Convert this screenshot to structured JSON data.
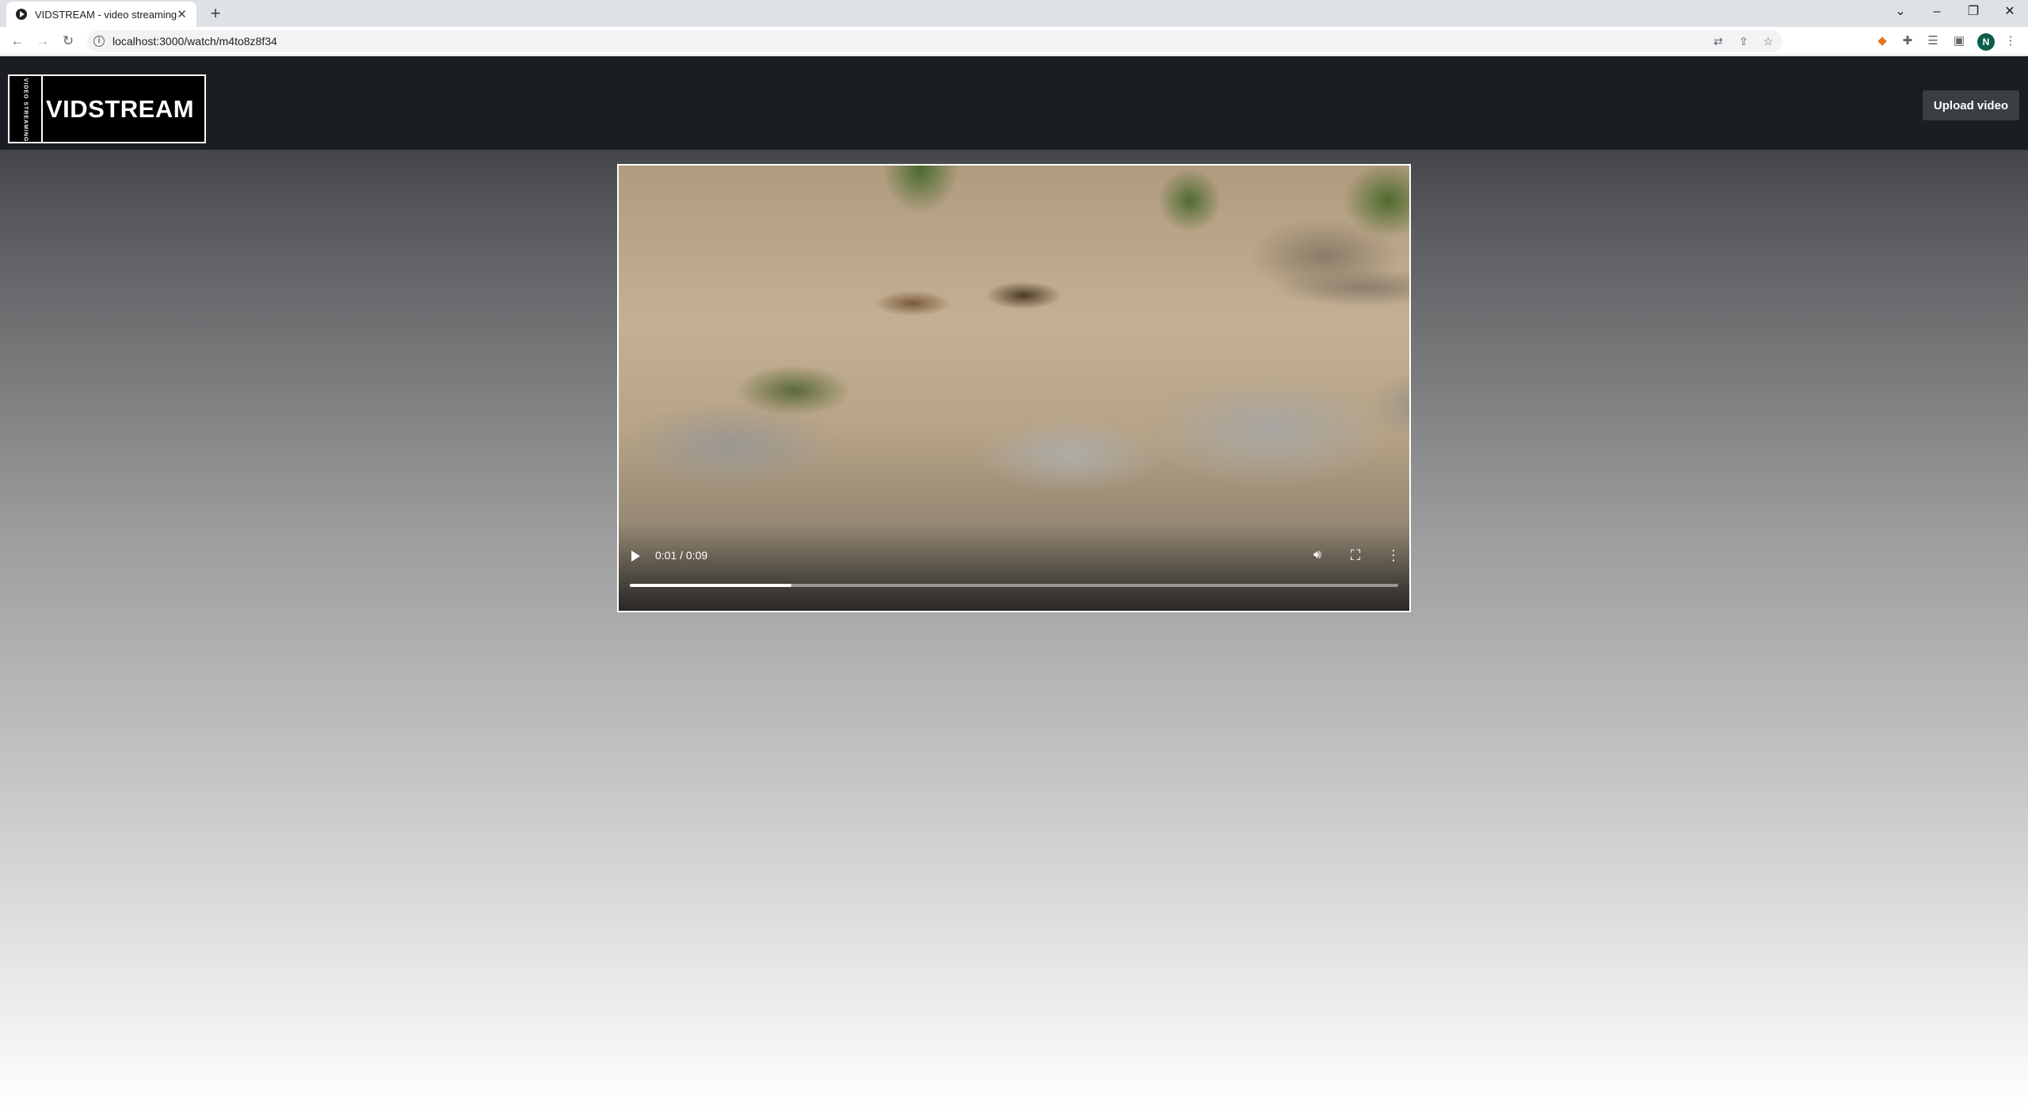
{
  "browser": {
    "tab_title": "VIDSTREAM - video streaming",
    "url": "localhost:3000/watch/m4to8z8f34",
    "profile_initial": "N"
  },
  "app": {
    "logo_word": "VIDSTREAM",
    "logo_side_text": "VIDEO STREAMING",
    "upload_label": "Upload video"
  },
  "video": {
    "time_display": "0:01 / 0:09",
    "buffered_fraction": 0.21
  }
}
